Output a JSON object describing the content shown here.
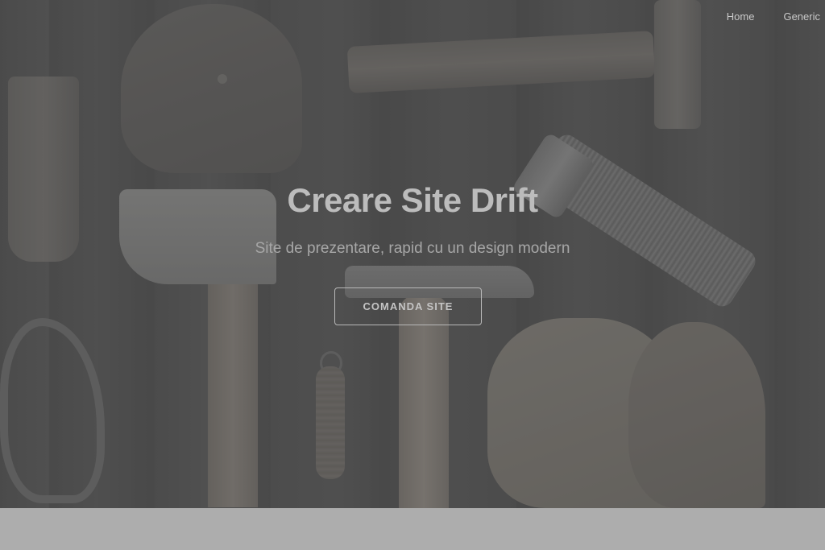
{
  "nav": {
    "items": [
      {
        "label": "Home"
      },
      {
        "label": "Generic"
      }
    ]
  },
  "hero": {
    "title": "Creare Site Drift",
    "subtitle": "Site de prezentare, rapid cu un design modern",
    "cta_label": "COMANDA SITE"
  },
  "colors": {
    "overlay": "#484848",
    "title_text": "#bcbcbc",
    "footer_band": "#adadad"
  }
}
